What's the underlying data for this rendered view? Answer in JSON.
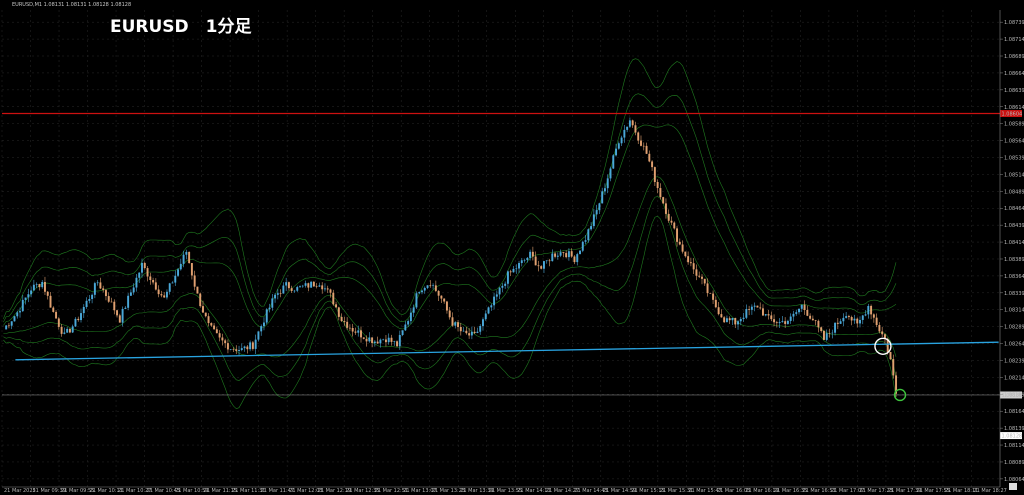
{
  "header": {
    "symbol_info": "EURUSD,M1  1.08131 1.08131 1.08128 1.08128"
  },
  "overlay_title": "EURUSD　1分足",
  "colors": {
    "background": "#000000",
    "grid": "#2a2a2a",
    "bull": "#4aa8d8",
    "bear": "#e0a070",
    "band": "#1f7a1f",
    "resistance": "#cc1111",
    "support": "#29a3e0",
    "white_circle": "#ffffff",
    "green_circle": "#3ec43e",
    "axis_text": "#b8b8b8"
  },
  "chart_data": {
    "type": "candlestick",
    "y_ticks": [
      "1.08739",
      "1.08714",
      "1.08689",
      "1.08664",
      "1.08639",
      "1.08614",
      "1.08589",
      "1.08564",
      "1.08539",
      "1.08514",
      "1.08489",
      "1.08464",
      "1.08439",
      "1.08414",
      "1.08389",
      "1.08364",
      "1.08339",
      "1.08314",
      "1.08289",
      "1.08264",
      "1.08239",
      "1.08214",
      "1.08189",
      "1.08164",
      "1.08139",
      "1.08114",
      "1.08089",
      "1.08064"
    ],
    "ylim": [
      1.08052,
      1.08757
    ],
    "x_ticks": [
      "21 Mar 2025",
      "21 Mar 09:39",
      "21 Mar 09:55",
      "21 Mar 10:11",
      "21 Mar 10:27",
      "21 Mar 10:43",
      "21 Mar 10:59",
      "21 Mar 11:15",
      "21 Mar 11:31",
      "21 Mar 11:47",
      "21 Mar 12:03",
      "21 Mar 12:19",
      "21 Mar 12:35",
      "21 Mar 12:51",
      "21 Mar 13:07",
      "21 Mar 13:23",
      "21 Mar 13:39",
      "21 Mar 13:55",
      "21 Mar 14:11",
      "21 Mar 14:27",
      "21 Mar 14:43",
      "21 Mar 14:59",
      "21 Mar 15:15",
      "21 Mar 15:31",
      "21 Mar 15:47",
      "21 Mar 16:03",
      "21 Mar 16:19",
      "21 Mar 16:35",
      "21 Mar 16:51",
      "21 Mar 17:07",
      "21 Mar 17:23",
      "21 Mar 17:39",
      "21 Mar 17:55",
      "21 Mar 18:11",
      "21 Mar 18:27"
    ],
    "resistance_level": 1.08604,
    "resistance_label": "1.08604",
    "current_price": 1.08188,
    "current_label": "1.08188",
    "extra_label": "1.08128",
    "support_line": {
      "start": [
        0,
        1.0824
      ],
      "end": [
        359,
        1.08266
      ]
    },
    "close_path": [
      [
        0,
        1.08285
      ],
      [
        5,
        1.0831
      ],
      [
        10,
        1.08345
      ],
      [
        14,
        1.08355
      ],
      [
        18,
        1.0831
      ],
      [
        22,
        1.08275
      ],
      [
        26,
        1.08295
      ],
      [
        30,
        1.08325
      ],
      [
        34,
        1.08355
      ],
      [
        38,
        1.0833
      ],
      [
        42,
        1.083
      ],
      [
        46,
        1.0834
      ],
      [
        50,
        1.0838
      ],
      [
        54,
        1.08355
      ],
      [
        58,
        1.0833
      ],
      [
        62,
        1.08365
      ],
      [
        66,
        1.084
      ],
      [
        70,
        1.08335
      ],
      [
        74,
        1.0829
      ],
      [
        78,
        1.0827
      ],
      [
        82,
        1.08258
      ],
      [
        86,
        1.08255
      ],
      [
        90,
        1.08262
      ],
      [
        94,
        1.083
      ],
      [
        98,
        1.08335
      ],
      [
        102,
        1.0835
      ],
      [
        106,
        1.08345
      ],
      [
        110,
        1.0835
      ],
      [
        114,
        1.08355
      ],
      [
        118,
        1.08335
      ],
      [
        122,
        1.083
      ],
      [
        126,
        1.08285
      ],
      [
        130,
        1.08275
      ],
      [
        134,
        1.08268
      ],
      [
        138,
        1.08272
      ],
      [
        142,
        1.08262
      ],
      [
        146,
        1.083
      ],
      [
        150,
        1.08345
      ],
      [
        154,
        1.08355
      ],
      [
        158,
        1.0833
      ],
      [
        162,
        1.08295
      ],
      [
        166,
        1.08278
      ],
      [
        170,
        1.08275
      ],
      [
        174,
        1.08305
      ],
      [
        178,
        1.08335
      ],
      [
        182,
        1.08365
      ],
      [
        186,
        1.0838
      ],
      [
        190,
        1.08395
      ],
      [
        194,
        1.08375
      ],
      [
        198,
        1.08395
      ],
      [
        202,
        1.084
      ],
      [
        206,
        1.0839
      ],
      [
        210,
        1.0842
      ],
      [
        214,
        1.0846
      ],
      [
        218,
        1.0851
      ],
      [
        222,
        1.08565
      ],
      [
        226,
        1.08595
      ],
      [
        228,
        1.08578
      ],
      [
        232,
        1.08545
      ],
      [
        236,
        1.08495
      ],
      [
        240,
        1.0845
      ],
      [
        244,
        1.0841
      ],
      [
        248,
        1.0838
      ],
      [
        252,
        1.08355
      ],
      [
        256,
        1.08325
      ],
      [
        260,
        1.083
      ],
      [
        264,
        1.08295
      ],
      [
        268,
        1.0831
      ],
      [
        272,
        1.0832
      ],
      [
        276,
        1.083
      ],
      [
        280,
        1.08295
      ],
      [
        284,
        1.083
      ],
      [
        288,
        1.0832
      ],
      [
        292,
        1.083
      ],
      [
        296,
        1.0827
      ],
      [
        300,
        1.0829
      ],
      [
        304,
        1.0831
      ],
      [
        308,
        1.0829
      ],
      [
        312,
        1.0832
      ],
      [
        316,
        1.08285
      ],
      [
        318,
        1.0827
      ],
      [
        320,
        1.0824
      ],
      [
        322,
        1.0819
      ]
    ],
    "white_circle_at": [
      318,
      1.0826
    ],
    "green_circle_at": [
      322,
      1.08188
    ]
  }
}
